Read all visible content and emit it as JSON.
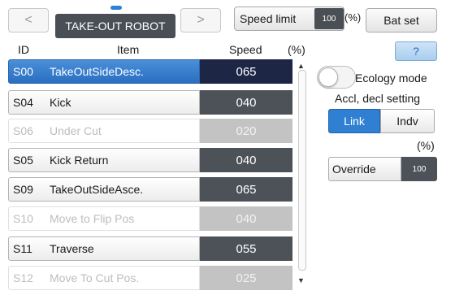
{
  "header": {
    "title": "TAKE-OUT ROBOT",
    "prev_icon": "chevron-left-icon",
    "next_icon": "chevron-right-icon",
    "prev_label": "<",
    "next_label": ">",
    "speed_limit_label": "Speed limit",
    "speed_limit_value": "100",
    "speed_limit_unit": "(%)",
    "bat_set_label": "Bat set"
  },
  "table": {
    "columns": {
      "id": "ID",
      "item": "Item",
      "speed": "Speed",
      "unit": "(%)"
    },
    "rows": [
      {
        "id": "S00",
        "item": "TakeOutSideDesc.",
        "speed": "065",
        "state": "selected"
      },
      {
        "id": "S04",
        "item": "Kick",
        "speed": "040",
        "state": "enabled"
      },
      {
        "id": "S06",
        "item": "Under Cut",
        "speed": "020",
        "state": "disabled"
      },
      {
        "id": "S05",
        "item": "Kick Return",
        "speed": "040",
        "state": "enabled"
      },
      {
        "id": "S09",
        "item": "TakeOutSideAsce.",
        "speed": "065",
        "state": "enabled"
      },
      {
        "id": "S10",
        "item": "Move to Flip Pos",
        "speed": "040",
        "state": "disabled"
      },
      {
        "id": "S11",
        "item": "Traverse",
        "speed": "055",
        "state": "enabled"
      },
      {
        "id": "S12",
        "item": "Move To Cut Pos.",
        "speed": "025",
        "state": "disabled"
      }
    ],
    "scroll_up_icon": "arrow-up-icon",
    "scroll_down_icon": "arrow-down-icon",
    "scroll_up_glyph": "▲",
    "scroll_down_glyph": "▼"
  },
  "side": {
    "help_label": "?",
    "ecology_mode_label": "Ecology mode",
    "ecology_mode_on": false,
    "accl_label": "Accl, decl setting",
    "link_label": "Link",
    "indv_label": "Indv",
    "selected_mode": "Link",
    "pct_label": "(%)",
    "override_label": "Override",
    "override_value": "100"
  },
  "colors": {
    "accent": "#2f7fd3",
    "speed_cell": "#4d5258",
    "selected_speed_cell": "#1e2646",
    "disabled_speed_cell": "#c3c3c3"
  }
}
